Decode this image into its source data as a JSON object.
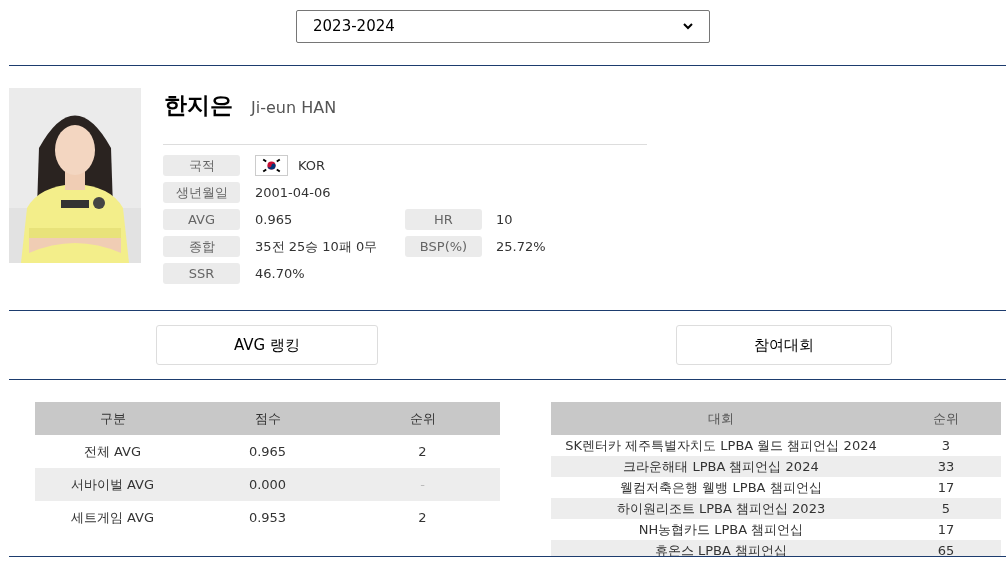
{
  "season_select": {
    "value": "2023-2024"
  },
  "player": {
    "name_korean": "한지은",
    "name_english": "Ji-eun HAN",
    "info": [
      {
        "label": "국적",
        "value": "KOR",
        "kind": "flag"
      },
      {
        "label": "생년월일",
        "value": "2001-04-06",
        "kind": "text"
      },
      {
        "label": "AVG",
        "value": "0.965",
        "kind": "text",
        "pair": {
          "label": "HR",
          "value": "10"
        }
      },
      {
        "label": "종합",
        "value": "35전 25승 10패 0무",
        "kind": "text",
        "pair": {
          "label": "BSP(%)",
          "value": "25.72%"
        }
      },
      {
        "label": "SSR",
        "value": "46.70%",
        "kind": "text"
      }
    ]
  },
  "section_buttons": [
    "AVG 랭킹",
    "참여대회"
  ],
  "avg_table": {
    "columns": [
      "구분",
      "점수",
      "순위"
    ],
    "rows": [
      [
        "전체 AVG",
        "0.965",
        "2"
      ],
      [
        "서바이벌 AVG",
        "0.000",
        "-"
      ],
      [
        "세트게임 AVG",
        "0.953",
        "2"
      ]
    ]
  },
  "tournament_table": {
    "columns": [
      "대회",
      "순위"
    ],
    "rows": [
      [
        "SK렌터카 제주특별자치도 LPBA 월드 챔피언십 2024",
        "3"
      ],
      [
        "크라운해태 LPBA 챔피언십 2024",
        "33"
      ],
      [
        "웰컴저축은행 웰뱅 LPBA 챔피언십",
        "17"
      ],
      [
        "하이원리조트 LPBA 챔피언십 2023",
        "5"
      ],
      [
        "NH농협카드 LPBA 챔피언십",
        "17"
      ],
      [
        "휴온스 LPBA 챔피언십",
        "65"
      ]
    ]
  }
}
